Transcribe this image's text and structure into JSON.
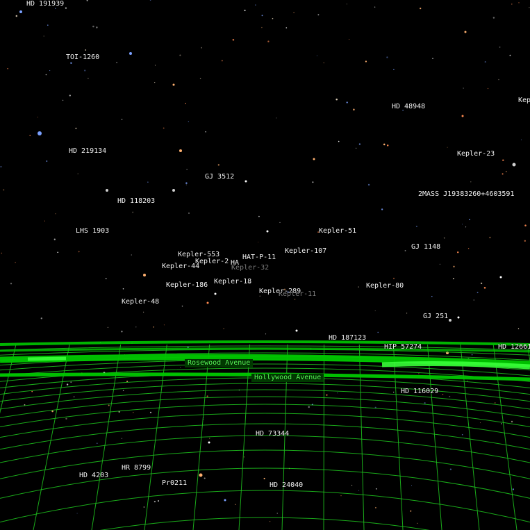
{
  "sky": {
    "background": "#000000",
    "star_colors": [
      "#ffffff",
      "#e8d8c0",
      "#ffb070",
      "#ff8a50",
      "#7aa0ff",
      "#cfcfcf"
    ]
  },
  "ground": {
    "grid_color": "#1ec81e",
    "street_color": "#00c800"
  },
  "labels": {
    "hd191939": "HD 191939",
    "toi1260": "TOI-1260",
    "hd48948": "HD 48948",
    "kep_edge": "Kep",
    "hd219134": "HD 219134",
    "kepler23": "Kepler-23",
    "gj3512": "GJ 3512",
    "twomass": "2MASS J19383260+4603591",
    "hd118203": "HD 118203",
    "lhs1903": "LHS 1903",
    "kepler51": "Kepler-51",
    "gj1148": "GJ 1148",
    "kepler107": "Kepler-107",
    "kepler553": "Kepler-553",
    "hatp11": "HAT-P-11",
    "kepler2x": "Kepler-2",
    "ha_frag": "HA",
    "kepler44x": "Kepler-44",
    "kepler32": "Kepler-32",
    "kepler186": "Kepler-186",
    "kepler18": "Kepler-18",
    "kepler289": "Kepler-289",
    "kepler11": "Kepler-11",
    "kepler80": "Kepler-80",
    "kepler48": "Kepler-48",
    "gj251": "GJ 251",
    "hd187123": "HD 187123",
    "hip57274": "HIP 57274",
    "hd12661": "HD 12661",
    "hd116029": "HD 116029",
    "hd73344": "HD 73344",
    "hr8799": "HR 8799",
    "hd4203": "HD 4203",
    "pr0211": "Pr0211",
    "hd24040": "HD 24040"
  },
  "streets": {
    "rosewood": "Rosewood Avenue",
    "hollywood": "Hollywood Avenue"
  }
}
